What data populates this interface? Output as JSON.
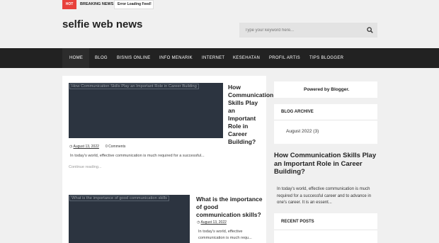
{
  "topbar": {
    "hot_label": "HOT",
    "breaking_label": "BREAKING NEWS",
    "feed_text": "Error Loading Feed!"
  },
  "header": {
    "site_title": "selfie web news",
    "search_placeholder": "Type your keyword here..."
  },
  "nav": {
    "items": [
      "HOME",
      "BLOG",
      "BISNIS ONLINE",
      "INFO MENARIK",
      "INTERNET",
      "KESEHATAN",
      "PROFIL ARTIS",
      "TIPS BLOGGER"
    ]
  },
  "posts": [
    {
      "image_alt": "How Communication Skills Play an Important Role in Career Building",
      "title": "How Communication Skills Play an Important Role in Career Building?",
      "date": "August 13, 2022",
      "comments": "0 Comments",
      "excerpt": "In today's world, effective communication is much required for a successful...",
      "more": "Continue reading..."
    },
    {
      "image_alt": "What is the importance of good communication skills",
      "title": "What is the importance of good communication skills?",
      "date": "August 13, 2022",
      "excerpt": "In today's world, effective communication is much requ..."
    }
  ],
  "sidebar": {
    "powered": "Powered by Blogger.",
    "archive_heading": "BLOG ARCHIVE",
    "archive_item": "August 2022 (3)",
    "popular_title": "How Communication Skills Play an Important Role in Career Building?",
    "popular_excerpt": "In today's world, effective communication is much required for a successful career and to advance in one's career. It is an essent...",
    "recent_heading": "RECENT POSTS"
  },
  "colors": {
    "hot": "#e8413c",
    "navbar": "#222222",
    "thumbnail": "#2c3440"
  },
  "icons": {
    "search": "search-icon"
  }
}
